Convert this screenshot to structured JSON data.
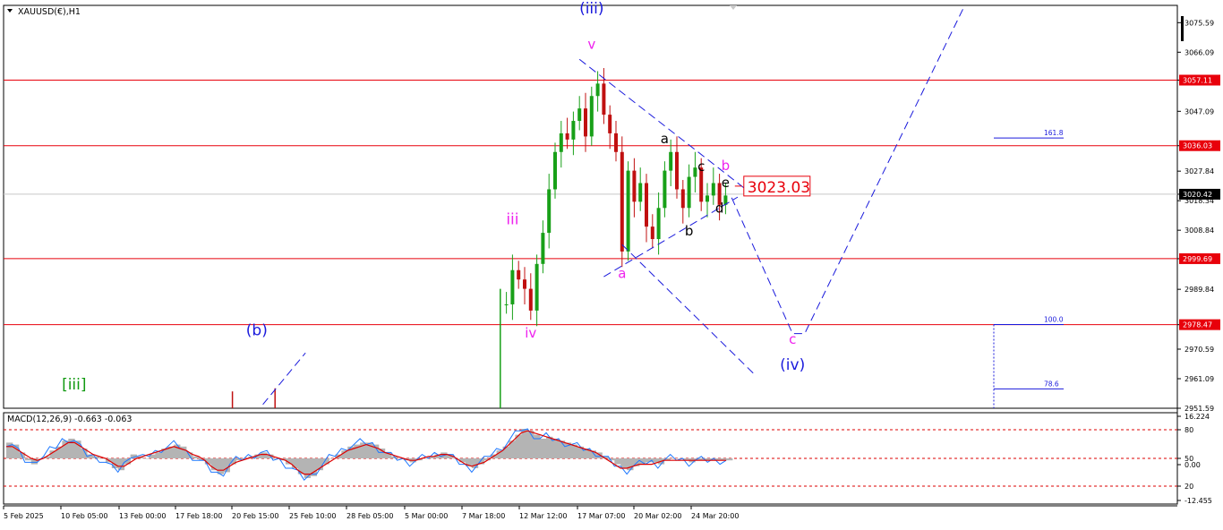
{
  "chart_data": [
    {
      "type": "line",
      "title": "XAUUSD(€),H1",
      "ylim": [
        2951.59,
        3080
      ],
      "y_ticks": [
        3075.59,
        3066.09,
        3057.11,
        3047.09,
        3036.03,
        3027.84,
        3020.42,
        3018.34,
        3008.84,
        2999.69,
        2989.84,
        2978.47,
        2970.59,
        2961.09,
        2951.59
      ],
      "horizontal_levels": [
        {
          "value": 3057.11,
          "label": "3057.11",
          "color": "#e8000b"
        },
        {
          "value": 3036.03,
          "label": "3036.03",
          "color": "#e8000b"
        },
        {
          "value": 2999.69,
          "label": "2999.69",
          "color": "#e8000b"
        },
        {
          "value": 2978.47,
          "label": "2978.47",
          "color": "#e8000b"
        }
      ],
      "current_price": {
        "value": 3020.42,
        "label": "3020.42"
      },
      "price_annotation": {
        "label": "3023.03",
        "value": 3023.03
      },
      "fib_levels": [
        {
          "label": "161.8",
          "value": 3038.5
        },
        {
          "label": "100.0",
          "value": 2978.5
        },
        {
          "label": "78.6",
          "value": 2957.8
        }
      ],
      "wave_labels": [
        {
          "text": "(iii)",
          "x_index": 96,
          "value": 3078.6,
          "color": "#1a1adc"
        },
        {
          "text": "v",
          "x_index": 96,
          "value": 3067.2,
          "color": "#ee22ee"
        },
        {
          "text": "iii",
          "x_index": 83,
          "value": 3010.8,
          "color": "#ee22ee"
        },
        {
          "text": "iv",
          "x_index": 86,
          "value": 2974.4,
          "color": "#ee22ee"
        },
        {
          "text": "a",
          "x_index": 101,
          "value": 2993.5,
          "color": "#ee22ee"
        },
        {
          "text": "a",
          "x_index": 108,
          "value": 3036.8,
          "color": "#000000"
        },
        {
          "text": "b",
          "x_index": 112,
          "value": 3007.2,
          "color": "#000000"
        },
        {
          "text": "c",
          "x_index": 114,
          "value": 3027.9,
          "color": "#000000"
        },
        {
          "text": "d",
          "x_index": 117,
          "value": 3014.5,
          "color": "#000000"
        },
        {
          "text": "e",
          "x_index": 118,
          "value": 3022.7,
          "color": "#000000"
        },
        {
          "text": "b",
          "x_index": 118,
          "value": 3028.2,
          "color": "#ee22ee"
        },
        {
          "text": "c",
          "x_index": 129,
          "value": 2972.3,
          "color": "#ee22ee"
        },
        {
          "text": "(iv)",
          "x_index": 129,
          "value": 2964.0,
          "color": "#1a1adc"
        },
        {
          "text": "(b)",
          "x_index": 41,
          "value": 2975.0,
          "color": "#1a1adc"
        },
        {
          "text": "[iii]",
          "x_index": 11,
          "value": 2957.6,
          "color": "#119911"
        }
      ],
      "projection_lines": [
        {
          "points": [
            [
              94,
              3063.8
            ],
            [
              121,
              3022.5
            ]
          ]
        },
        {
          "points": [
            [
              98,
              2993.9
            ],
            [
              120,
              3019.5
            ]
          ]
        },
        {
          "points": [
            [
              101,
              3004.2
            ],
            [
              123,
              2962.0
            ]
          ]
        },
        {
          "points": [
            [
              119,
              3019.3
            ],
            [
              129,
              2975.6
            ],
            [
              131,
              2975.6
            ],
            [
              157,
              3080
            ]
          ]
        },
        {
          "points": [
            [
              42,
              2952.8
            ],
            [
              49,
              2969.4
            ]
          ]
        }
      ],
      "x_tick_labels": [
        "5 Feb 2025",
        "10 Feb 05:00",
        "13 Feb 00:00",
        "17 Feb 18:00",
        "20 Feb 15:00",
        "25 Feb 10:00",
        "28 Feb 05:00",
        "5 Mar 00:00",
        "7 Mar 18:00",
        "12 Mar 12:00",
        "17 Mar 07:00",
        "20 Mar 02:00",
        "24 Mar 20:00"
      ],
      "series": [
        {
          "name": "XAUUSD",
          "values": [
            null,
            null,
            null,
            null,
            null,
            null,
            null,
            null,
            null,
            null,
            null,
            null,
            null,
            null,
            null,
            null,
            null,
            null,
            null,
            null,
            null,
            null,
            null,
            null,
            null,
            null,
            null,
            null,
            null,
            null,
            null,
            null,
            null,
            null,
            null,
            null,
            null,
            null,
            null,
            null,
            null,
            null,
            null,
            null,
            null,
            null,
            null,
            null,
            null,
            null,
            null,
            null,
            null,
            null,
            null,
            null,
            null,
            null,
            null,
            null,
            null,
            null,
            null,
            null,
            null,
            null,
            null,
            null,
            null,
            null,
            null,
            null,
            null,
            null,
            null,
            null,
            null,
            null,
            null,
            null,
            null,
            null,
            2985,
            2996,
            2993,
            2990,
            2983,
            2998,
            3008,
            3022,
            3034,
            3040,
            3038,
            3044,
            3048,
            3039,
            3052,
            3056,
            3046,
            3040,
            3034,
            3002,
            3028,
            3018,
            3024,
            3010,
            3006,
            3016,
            3028,
            3034,
            3022,
            3016,
            3026,
            3029,
            3018,
            3020,
            3024,
            3017,
            3020
          ]
        }
      ]
    },
    {
      "type": "line",
      "title": "MACD(12,26,9) -0.663 -0.063",
      "ylim": [
        -12.455,
        16.224
      ],
      "y_ticks": [
        16.224,
        80,
        50,
        0.0,
        20,
        -12.455
      ],
      "y_tick_labels": [
        "16.224",
        "80",
        "50",
        "0.00",
        "20",
        "-12.455"
      ],
      "histogram": [
        8,
        7,
        3,
        -1,
        -3,
        0,
        1,
        4,
        6,
        9,
        10,
        9,
        5,
        2,
        1,
        0,
        -2,
        -5,
        -6,
        -3,
        2,
        1,
        0,
        2,
        3,
        5,
        6,
        7,
        6,
        3,
        1,
        -1,
        -3,
        -6,
        -8,
        -7,
        -3,
        -1,
        0,
        1,
        2,
        3,
        2,
        0,
        -1,
        -3,
        -5,
        -8,
        -10,
        -9,
        -6,
        -3,
        0,
        2,
        4,
        6,
        7,
        8,
        8,
        7,
        5,
        3,
        1,
        0,
        -1,
        -2,
        -1,
        0,
        1,
        2,
        3,
        2,
        0,
        -2,
        -4,
        -5,
        -3,
        -1,
        2,
        4,
        6,
        9,
        12,
        15,
        14,
        12,
        10,
        11,
        10,
        9,
        8,
        7,
        6,
        5,
        4,
        3,
        1,
        -1,
        -3,
        -5,
        -6,
        -4,
        -3,
        -2,
        -2,
        -3,
        -1,
        0,
        0,
        -1,
        -2,
        -1,
        -1,
        -1,
        -1,
        -1,
        -1
      ],
      "signal": [
        6,
        6,
        4,
        2,
        0,
        -1,
        0,
        2,
        4,
        6,
        8,
        8,
        6,
        4,
        2,
        1,
        0,
        -2,
        -4,
        -4,
        -2,
        0,
        1,
        2,
        3,
        4,
        5,
        6,
        5,
        4,
        2,
        1,
        -1,
        -4,
        -6,
        -6,
        -4,
        -2,
        -1,
        0,
        1,
        2,
        2,
        1,
        0,
        -1,
        -3,
        -6,
        -8,
        -8,
        -6,
        -4,
        -2,
        0,
        2,
        4,
        5,
        6,
        7,
        6,
        5,
        3,
        2,
        1,
        0,
        -1,
        -1,
        0,
        1,
        1,
        2,
        2,
        1,
        -1,
        -3,
        -4,
        -3,
        -2,
        0,
        2,
        4,
        7,
        10,
        13,
        14,
        13,
        12,
        11,
        10,
        9,
        8,
        7,
        6,
        5,
        4,
        3,
        1,
        -1,
        -3,
        -5,
        -5,
        -4,
        -3,
        -3,
        -3,
        -2,
        -1,
        -1,
        -1,
        -1,
        -1,
        -1,
        -1,
        -1,
        -1,
        -1,
        -1
      ],
      "main_line_color": "#1e78ff",
      "signal_color": "#dd0000",
      "levels": [
        80,
        50,
        20
      ]
    }
  ]
}
